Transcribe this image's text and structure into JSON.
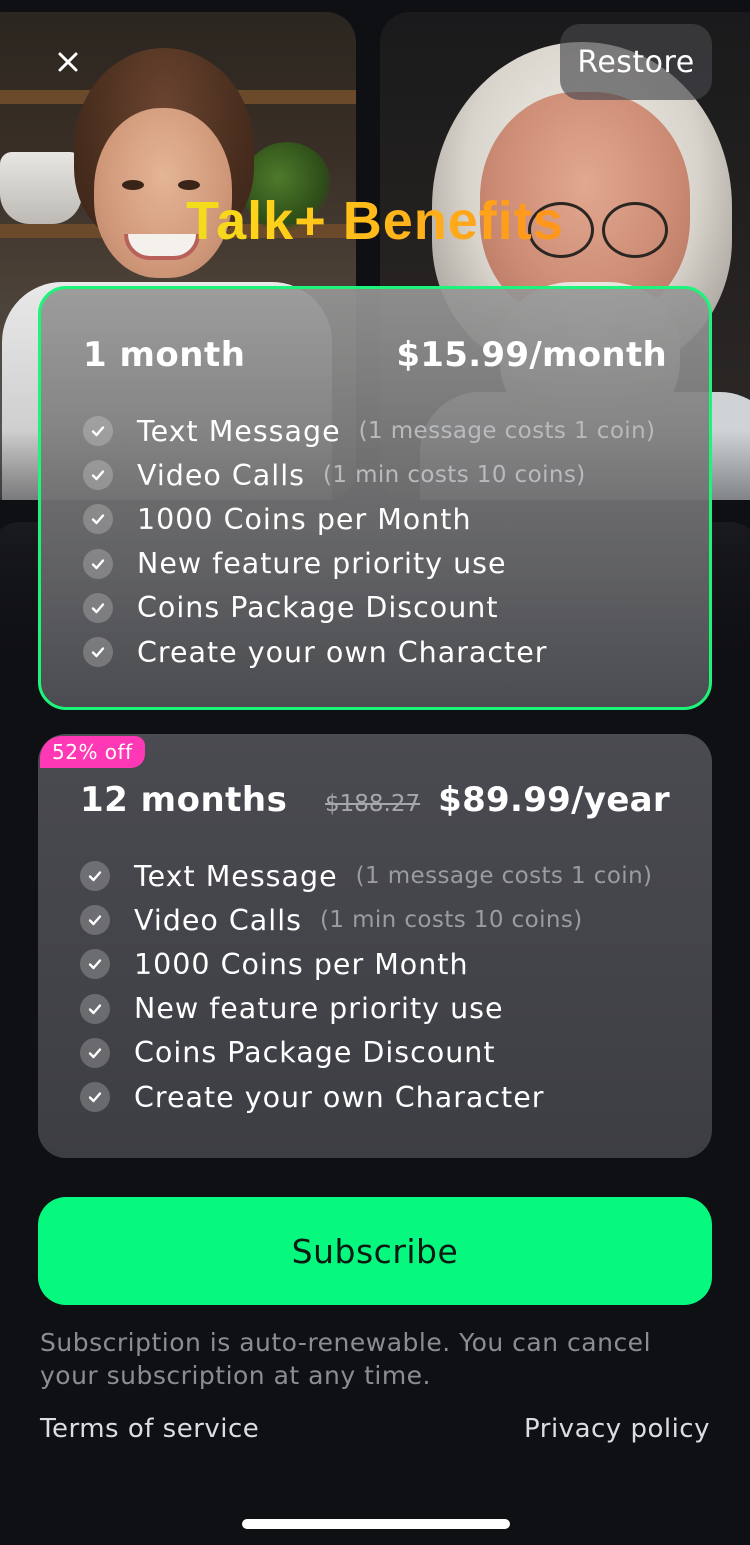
{
  "header": {
    "close_icon": "close-icon",
    "restore_label": "Restore",
    "title": "Talk+ Benefits"
  },
  "plans": [
    {
      "name": "1 month",
      "price": "$15.99/month",
      "selected": true,
      "benefits": [
        {
          "text": "Text Message",
          "note": "(1 message costs 1 coin)"
        },
        {
          "text": "Video Calls",
          "note": "(1 min costs 10 coins)"
        },
        {
          "text": "1000 Coins per Month",
          "note": ""
        },
        {
          "text": "New feature priority use",
          "note": ""
        },
        {
          "text": "Coins Package Discount",
          "note": ""
        },
        {
          "text": "Create your own Character",
          "note": ""
        }
      ]
    },
    {
      "name": "12 months",
      "badge": "52% off",
      "old_price": "$188.27",
      "price": "$89.99/year",
      "selected": false,
      "benefits": [
        {
          "text": "Text Message",
          "note": "(1 message costs 1 coin)"
        },
        {
          "text": "Video Calls",
          "note": "(1 min costs 10 coins)"
        },
        {
          "text": "1000 Coins per Month",
          "note": ""
        },
        {
          "text": "New feature priority use",
          "note": ""
        },
        {
          "text": "Coins Package Discount",
          "note": ""
        },
        {
          "text": "Create your own Character",
          "note": ""
        }
      ]
    }
  ],
  "subscribe_label": "Subscribe",
  "fine_print": "Subscription is auto-renewable. You can cancel your subscription at any time.",
  "links": {
    "terms": "Terms of service",
    "privacy": "Privacy policy"
  },
  "colors": {
    "accent_green": "#06f97e",
    "selected_border": "#1df57a",
    "badge_pink": "#ff39b5",
    "background": "#0f1014"
  }
}
